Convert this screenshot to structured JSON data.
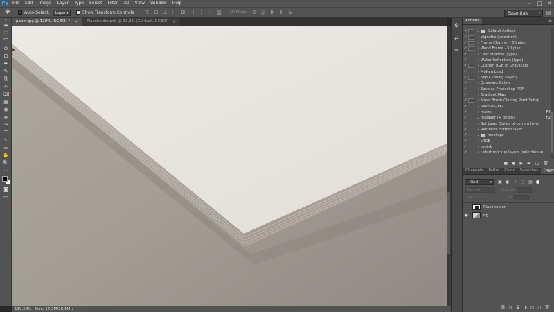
{
  "app": {
    "logo": "Ps",
    "menu": [
      "File",
      "Edit",
      "Image",
      "Layer",
      "Type",
      "Select",
      "Filter",
      "3D",
      "View",
      "Window",
      "Help"
    ],
    "window_controls": [
      "–",
      "□",
      "✕"
    ]
  },
  "options": {
    "auto_select_label": "Auto-Select:",
    "auto_select_checked": false,
    "auto_select_target": "Layer",
    "show_transform_label": "Show Transform Controls",
    "show_transform_checked": true,
    "mode_3d_label": "3D Mode:",
    "workspace": "Essentials"
  },
  "tabs": [
    {
      "label": "paper.jpg @ 120% (RGB/8) *",
      "active": true
    },
    {
      "label": "Placeholder.psb @ 33,3% (CV-dark, RGB/8)",
      "active": false
    }
  ],
  "status": {
    "zoom": "119,58%",
    "doc": "Doc: 17,2M/28,1M",
    "arrow": "▸"
  },
  "actions_panel": {
    "title": "Actions",
    "menu_icon": "≡",
    "items": [
      {
        "check": "✓",
        "dialog": true,
        "chevron": "⌄",
        "folder": true,
        "name": "Default Actions",
        "key": ""
      },
      {
        "check": "✓",
        "dialog": true,
        "chevron": "›",
        "folder": false,
        "name": "Vignette (selection)",
        "key": ""
      },
      {
        "check": "✓",
        "dialog": true,
        "chevron": "›",
        "folder": false,
        "name": "Frame Channel - 50 pixel",
        "key": ""
      },
      {
        "check": "✓",
        "dialog": true,
        "chevron": "›",
        "folder": false,
        "name": "Wood Frame - 50 pixel",
        "key": ""
      },
      {
        "check": "✓",
        "dialog": false,
        "chevron": "›",
        "folder": false,
        "name": "Cast Shadow (type)",
        "key": ""
      },
      {
        "check": "✓",
        "dialog": false,
        "chevron": "›",
        "folder": false,
        "name": "Water Reflection (type)",
        "key": ""
      },
      {
        "check": "✓",
        "dialog": true,
        "chevron": "›",
        "folder": false,
        "name": "Custom RGB to Grayscale",
        "key": ""
      },
      {
        "check": "✓",
        "dialog": false,
        "chevron": "›",
        "folder": false,
        "name": "Molten Lead",
        "key": ""
      },
      {
        "check": "✓",
        "dialog": true,
        "chevron": "›",
        "folder": false,
        "name": "Sepia Toning (layer)",
        "key": ""
      },
      {
        "check": "✓",
        "dialog": false,
        "chevron": "›",
        "folder": false,
        "name": "Quadrant Colors",
        "key": ""
      },
      {
        "check": "✓",
        "dialog": false,
        "chevron": "›",
        "folder": false,
        "name": "Save as Photoshop PDF",
        "key": ""
      },
      {
        "check": "✓",
        "dialog": false,
        "chevron": "›",
        "folder": false,
        "name": "Gradient Map",
        "key": ""
      },
      {
        "check": "✓",
        "dialog": true,
        "chevron": "›",
        "folder": false,
        "name": "Mixer Brush Cloning Paint Setup",
        "key": ""
      },
      {
        "check": "✓",
        "dialog": false,
        "chevron": "›",
        "folder": false,
        "name": "Save-as-JPG",
        "key": ""
      },
      {
        "check": "✓",
        "dialog": false,
        "chevron": "›",
        "folder": false,
        "name": "resize",
        "key": "F4"
      },
      {
        "check": "✓",
        "dialog": false,
        "chevron": "⌄",
        "folder": false,
        "name": "redlayer (+ origin)",
        "key": "F2"
      },
      {
        "check": "✓",
        "dialog": false,
        "chevron": "›",
        "folder": false,
        "name": "  Set Layer Styles of current layer",
        "key": ""
      },
      {
        "check": "✓",
        "dialog": false,
        "chevron": "›",
        "folder": false,
        "name": "  Rasterize current layer",
        "key": ""
      },
      {
        "check": "✓",
        "dialog": false,
        "chevron": "⌄",
        "folder": true,
        "name": "mockups",
        "key": ""
      },
      {
        "check": "✓",
        "dialog": false,
        "chevron": "›",
        "folder": false,
        "name": "sRGB",
        "key": ""
      },
      {
        "check": "✓",
        "dialog": false,
        "chevron": "›",
        "folder": false,
        "name": "topink",
        "key": ""
      },
      {
        "check": "✓",
        "dialog": false,
        "chevron": "›",
        "folder": false,
        "name": "t-shirt mockup layers (selection acti...",
        "key": ""
      }
    ],
    "footer_icons": [
      "■",
      "●",
      "▶",
      "▬",
      "◫",
      "🗑"
    ]
  },
  "layers_panel": {
    "tabs": [
      {
        "label": "Channels",
        "active": false
      },
      {
        "label": "Paths",
        "active": false
      },
      {
        "label": "Color",
        "active": false
      },
      {
        "label": "Swatches",
        "active": false
      },
      {
        "label": "Layers",
        "active": true
      }
    ],
    "menu_icon": "≡",
    "kind_label": "Kind",
    "filter_icons": [
      "▣",
      "◐",
      "T",
      "⬚",
      "▤"
    ],
    "blend_mode": "Normal",
    "opacity_label": "Opacity:",
    "lock_label": "Lock:",
    "fill_label": "Fill:",
    "layers": [
      {
        "name": "Placeholder",
        "visible": false,
        "thumb": "smart"
      },
      {
        "name": "bg",
        "visible": true,
        "thumb": "photo"
      }
    ],
    "footer_icons": [
      "⛓",
      "fx",
      "◘",
      "◑",
      "▭",
      "◻",
      "🗑"
    ]
  },
  "tools": [
    "✥",
    "⬚",
    "⌒",
    "⊘",
    "⊡",
    "✒",
    "✎",
    "⎘",
    "✍",
    "⌫",
    "▦",
    "◉",
    "◈",
    "✑",
    "T",
    "↖",
    "▭",
    "✋",
    "🔍",
    "⋯"
  ],
  "strip_icons": [
    "⚙",
    "⇄",
    "✂"
  ]
}
